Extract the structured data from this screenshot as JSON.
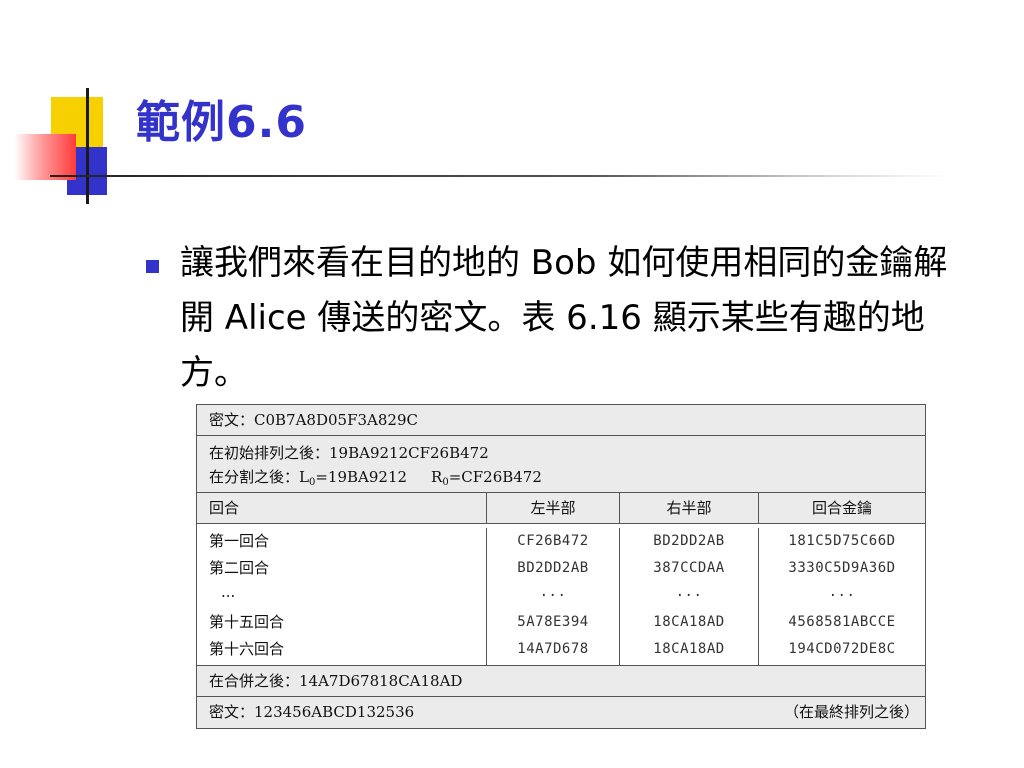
{
  "slide": {
    "title": "範例6.6",
    "bullet_text": "讓我們來看在目的地的 Bob 如何使用相同的金鑰解開 Alice 傳送的密文。表 6.16 顯示某些有趣的地方。",
    "accent_color": "#3333cc"
  },
  "table": {
    "ciphertext_row": "密文：C0B7A8D05F3A829C",
    "after_initial_perm": "在初始排列之後：19BA9212CF26B472",
    "after_split_prefix": "在分割之後：L",
    "l0_sub": "0",
    "l0_value": "=19BA9212",
    "r0_prefix": "R",
    "r0_sub": "0",
    "r0_value": "=CF26B472",
    "headers": [
      "回合",
      "左半部",
      "右半部",
      "回合金鑰"
    ],
    "rounds": [
      {
        "name": "第一回合",
        "left": "CF26B472",
        "right": "BD2DD2AB",
        "key": "181C5D75C66D"
      },
      {
        "name": "第二回合",
        "left": "BD2DD2AB",
        "right": "387CCDAA",
        "key": "3330C5D9A36D"
      },
      {
        "name": "...",
        "left": "...",
        "right": "...",
        "key": "..."
      },
      {
        "name": "第十五回合",
        "left": "5A78E394",
        "right": "18CA18AD",
        "key": "4568581ABCCE"
      },
      {
        "name": "第十六回合",
        "left": "14A7D678",
        "right": "18CA18AD",
        "key": "194CD072DE8C"
      }
    ],
    "after_combine": "在合併之後：14A7D67818CA18AD",
    "final_plaintext": "密文：123456ABCD132536",
    "final_note": "（在最終排列之後）"
  }
}
